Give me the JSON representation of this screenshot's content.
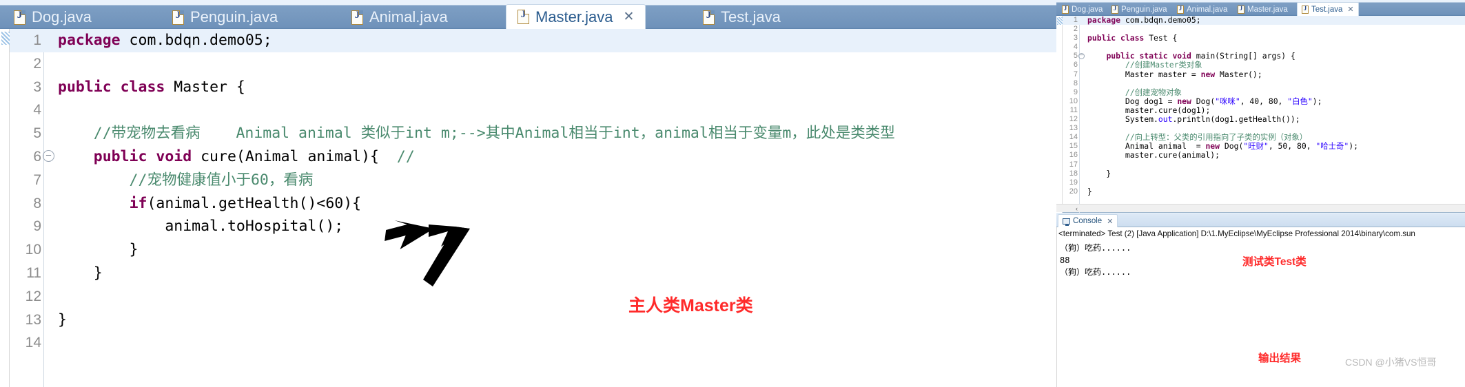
{
  "left_editor": {
    "tabs": [
      {
        "label": "Dog.java",
        "icon": "java-file-icon",
        "active": false
      },
      {
        "label": "Penguin.java",
        "icon": "java-file-icon",
        "active": false
      },
      {
        "label": "Animal.java",
        "icon": "java-file-icon",
        "active": false
      },
      {
        "label": "Master.java",
        "icon": "java-file-icon",
        "active": true,
        "close_icon": "✕"
      },
      {
        "label": "Test.java",
        "icon": "java-file-icon",
        "active": false
      }
    ],
    "lines": [
      {
        "n": "1",
        "fold": false,
        "highlight": true,
        "segments": [
          {
            "t": "package",
            "c": "k"
          },
          {
            "t": " com.bdqn.demo05;",
            "c": "pl"
          }
        ]
      },
      {
        "n": "2",
        "fold": false,
        "highlight": false,
        "segments": []
      },
      {
        "n": "3",
        "fold": false,
        "highlight": false,
        "segments": [
          {
            "t": "public class",
            "c": "k"
          },
          {
            "t": " Master {",
            "c": "pl"
          }
        ]
      },
      {
        "n": "4",
        "fold": false,
        "highlight": false,
        "segments": []
      },
      {
        "n": "5",
        "fold": false,
        "highlight": false,
        "segments": [
          {
            "t": "    //带宠物去看病    Animal animal 类似于int m;-->其中Animal相当于int，animal相当于变量m，此处是类类型",
            "c": "cm"
          }
        ]
      },
      {
        "n": "6",
        "fold": true,
        "highlight": false,
        "segments": [
          {
            "t": "    ",
            "c": "pl"
          },
          {
            "t": "public void",
            "c": "k"
          },
          {
            "t": " cure(Animal animal){  ",
            "c": "pl"
          },
          {
            "t": "//",
            "c": "cm"
          }
        ]
      },
      {
        "n": "7",
        "fold": false,
        "highlight": false,
        "segments": [
          {
            "t": "        //宠物健康值小于60，看病",
            "c": "cm"
          }
        ]
      },
      {
        "n": "8",
        "fold": false,
        "highlight": false,
        "segments": [
          {
            "t": "        ",
            "c": "pl"
          },
          {
            "t": "if",
            "c": "k"
          },
          {
            "t": "(animal.getHealth()<60){",
            "c": "pl"
          }
        ]
      },
      {
        "n": "9",
        "fold": false,
        "highlight": false,
        "segments": [
          {
            "t": "            animal.toHospital();",
            "c": "pl"
          }
        ]
      },
      {
        "n": "10",
        "fold": false,
        "highlight": false,
        "segments": [
          {
            "t": "        }",
            "c": "pl"
          }
        ]
      },
      {
        "n": "11",
        "fold": false,
        "highlight": false,
        "segments": [
          {
            "t": "    }",
            "c": "pl"
          }
        ]
      },
      {
        "n": "12",
        "fold": false,
        "highlight": false,
        "segments": []
      },
      {
        "n": "13",
        "fold": false,
        "highlight": false,
        "segments": [
          {
            "t": "}",
            "c": "pl"
          }
        ]
      },
      {
        "n": "14",
        "fold": false,
        "highlight": false,
        "segments": []
      }
    ]
  },
  "right_editor": {
    "tabs": [
      {
        "label": "Dog.java",
        "icon": "java-file-icon",
        "active": false
      },
      {
        "label": "Penguin.java",
        "icon": "java-file-icon",
        "active": false
      },
      {
        "label": "Animal.java",
        "icon": "java-file-icon",
        "active": false
      },
      {
        "label": "Master.java",
        "icon": "java-file-icon",
        "active": false
      },
      {
        "label": "Test.java",
        "icon": "java-file-icon",
        "active": true,
        "close_icon": "✕"
      }
    ],
    "lines": [
      {
        "n": "1",
        "fold": false,
        "highlight": true,
        "segments": [
          {
            "t": "package",
            "c": "k"
          },
          {
            "t": " com.bdqn.demo05;",
            "c": "pl"
          }
        ]
      },
      {
        "n": "2",
        "fold": false,
        "highlight": false,
        "segments": []
      },
      {
        "n": "3",
        "fold": false,
        "highlight": false,
        "segments": [
          {
            "t": "public class",
            "c": "k"
          },
          {
            "t": " Test {",
            "c": "pl"
          }
        ]
      },
      {
        "n": "4",
        "fold": false,
        "highlight": false,
        "segments": []
      },
      {
        "n": "5",
        "fold": true,
        "highlight": false,
        "segments": [
          {
            "t": "    ",
            "c": "pl"
          },
          {
            "t": "public static void",
            "c": "k"
          },
          {
            "t": " main(String[] args) {",
            "c": "pl"
          }
        ]
      },
      {
        "n": "6",
        "fold": false,
        "highlight": false,
        "segments": [
          {
            "t": "        //创建Master类对象",
            "c": "cm"
          }
        ]
      },
      {
        "n": "7",
        "fold": false,
        "highlight": false,
        "segments": [
          {
            "t": "        Master master = ",
            "c": "pl"
          },
          {
            "t": "new",
            "c": "k"
          },
          {
            "t": " Master();",
            "c": "pl"
          }
        ]
      },
      {
        "n": "8",
        "fold": false,
        "highlight": false,
        "segments": []
      },
      {
        "n": "9",
        "fold": false,
        "highlight": false,
        "segments": [
          {
            "t": "        //创建宠物对象",
            "c": "cm"
          }
        ]
      },
      {
        "n": "10",
        "fold": false,
        "highlight": false,
        "segments": [
          {
            "t": "        Dog dog1 = ",
            "c": "pl"
          },
          {
            "t": "new",
            "c": "k"
          },
          {
            "t": " Dog(",
            "c": "pl"
          },
          {
            "t": "\"咪咪\"",
            "c": "st"
          },
          {
            "t": ", 40, 80, ",
            "c": "pl"
          },
          {
            "t": "\"白色\"",
            "c": "st"
          },
          {
            "t": ");",
            "c": "pl"
          }
        ]
      },
      {
        "n": "11",
        "fold": false,
        "highlight": false,
        "segments": [
          {
            "t": "        master.cure(dog1);",
            "c": "pl"
          }
        ]
      },
      {
        "n": "12",
        "fold": false,
        "highlight": false,
        "segments": [
          {
            "t": "        System.",
            "c": "pl"
          },
          {
            "t": "out",
            "c": "st"
          },
          {
            "t": ".println(dog1.getHealth());",
            "c": "pl"
          }
        ]
      },
      {
        "n": "13",
        "fold": false,
        "highlight": false,
        "segments": []
      },
      {
        "n": "14",
        "fold": false,
        "highlight": false,
        "segments": [
          {
            "t": "        //向上转型：父类的引用指向了子类的实例（对象）",
            "c": "cm"
          }
        ]
      },
      {
        "n": "15",
        "fold": false,
        "highlight": false,
        "segments": [
          {
            "t": "        Animal animal  = ",
            "c": "pl"
          },
          {
            "t": "new",
            "c": "k"
          },
          {
            "t": " Dog(",
            "c": "pl"
          },
          {
            "t": "\"旺财\"",
            "c": "st"
          },
          {
            "t": ", 50, 80, ",
            "c": "pl"
          },
          {
            "t": "\"哈士奇\"",
            "c": "st"
          },
          {
            "t": ");",
            "c": "pl"
          }
        ]
      },
      {
        "n": "16",
        "fold": false,
        "highlight": false,
        "segments": [
          {
            "t": "        master.cure(animal);",
            "c": "pl"
          }
        ]
      },
      {
        "n": "17",
        "fold": false,
        "highlight": false,
        "segments": []
      },
      {
        "n": "18",
        "fold": false,
        "highlight": false,
        "segments": [
          {
            "t": "    }",
            "c": "pl"
          }
        ]
      },
      {
        "n": "19",
        "fold": false,
        "highlight": false,
        "segments": []
      },
      {
        "n": "20",
        "fold": false,
        "highlight": false,
        "segments": [
          {
            "t": "}",
            "c": "pl"
          }
        ]
      }
    ],
    "scroll_left_arrow": "‹"
  },
  "console": {
    "tab_label": "Console",
    "tab_icon": "monitor-icon",
    "close_icon": "✕",
    "header": "<terminated> Test (2) [Java Application] D:\\1.MyEclipse\\MyEclipse Professional 2014\\binary\\com.sun",
    "output_lines": [
      "（狗）吃药......",
      "88",
      "（狗）吃药......"
    ]
  },
  "annotations": {
    "master_note": "主人类Master类",
    "test_note": "测试类Test类",
    "output_note": "输出结果",
    "watermark": "CSDN @小猪VS恒哥",
    "arrow_icon": "arrow-pointer",
    "accent_red": "#ff2a2a",
    "tab_blue": "#6f92ba",
    "keyword_color": "#7f0055",
    "comment_color": "#4a8a6e",
    "string_color": "#2a00ff"
  }
}
